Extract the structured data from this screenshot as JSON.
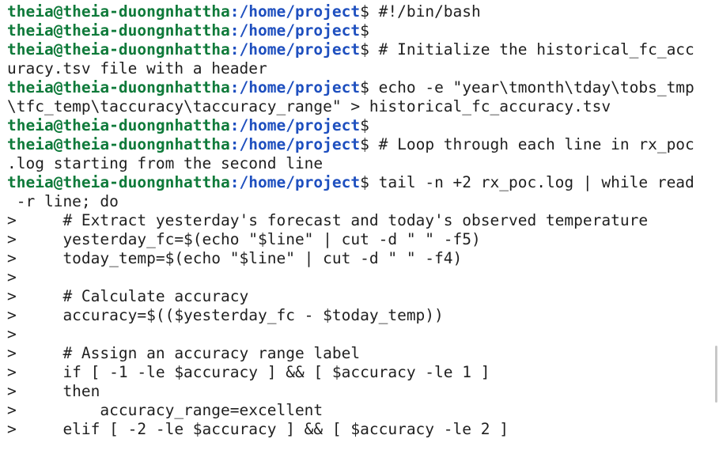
{
  "prompt": {
    "user_host": "theia@theia-duongnhattha",
    "path": ":/home/project",
    "symbol": "$ "
  },
  "lines": [
    {
      "prompt": true,
      "cmd": "#!/bin/bash"
    },
    {
      "prompt": true,
      "cmd": ""
    },
    {
      "prompt": true,
      "cmd": "# Initialize the historical_fc_acc"
    },
    {
      "prompt": false,
      "text": "uracy.tsv file with a header"
    },
    {
      "prompt": true,
      "cmd": "echo -e \"year\\tmonth\\tday\\tobs_tmp"
    },
    {
      "prompt": false,
      "text": "\\tfc_temp\\taccuracy\\taccuracy_range\" > historical_fc_accuracy.tsv"
    },
    {
      "prompt": true,
      "cmd": ""
    },
    {
      "prompt": true,
      "cmd": "# Loop through each line in rx_poc"
    },
    {
      "prompt": false,
      "text": ".log starting from the second line"
    },
    {
      "prompt": true,
      "cmd": "tail -n +2 rx_poc.log | while read"
    },
    {
      "prompt": false,
      "text": " -r line; do"
    },
    {
      "prompt": false,
      "text": ">     # Extract yesterday's forecast and today's observed temperature"
    },
    {
      "prompt": false,
      "text": ">     yesterday_fc=$(echo \"$line\" | cut -d \" \" -f5)"
    },
    {
      "prompt": false,
      "text": ">     today_temp=$(echo \"$line\" | cut -d \" \" -f4)"
    },
    {
      "prompt": false,
      "text": ">"
    },
    {
      "prompt": false,
      "text": ">     # Calculate accuracy"
    },
    {
      "prompt": false,
      "text": ">     accuracy=$(($yesterday_fc - $today_temp))"
    },
    {
      "prompt": false,
      "text": ">"
    },
    {
      "prompt": false,
      "text": ">     # Assign an accuracy range label"
    },
    {
      "prompt": false,
      "text": ">     if [ -1 -le $accuracy ] && [ $accuracy -le 1 ]"
    },
    {
      "prompt": false,
      "text": ">     then"
    },
    {
      "prompt": false,
      "text": ">         accuracy_range=excellent"
    },
    {
      "prompt": false,
      "text": ">     elif [ -2 -le $accuracy ] && [ $accuracy -le 2 ]"
    }
  ]
}
